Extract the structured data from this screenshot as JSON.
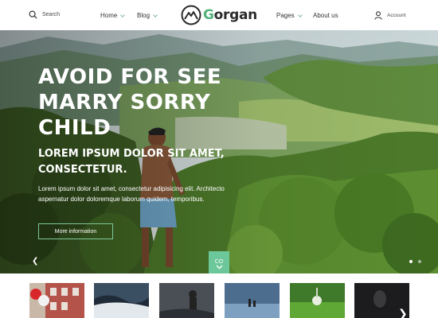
{
  "nav": {
    "search_label": "Search",
    "home_label": "Home",
    "blog_label": "Blog",
    "pages_label": "Pages",
    "about_label": "About us",
    "account_label": "Account",
    "logo_first": "G",
    "logo_rest": "organ"
  },
  "hero": {
    "title": "AVOID FOR SEE MARRY SORRY CHILD",
    "subtitle": "LOREM IPSUM DOLOR SIT AMET, CONSECTETUR.",
    "description": "Lorem ipsum dolor sit amet, consectetur adipisicing elit. Architecto aspernatur dolor doloremque laborum quidem, temporibus.",
    "button_label": "More information",
    "scroll_label": "CO"
  },
  "colors": {
    "accent": "#54b37c",
    "scroll_button": "#6cc79a"
  },
  "icons": {
    "search": "search-icon",
    "account": "user-icon",
    "logo": "mountain-logo-icon",
    "prev": "chevron-left-icon",
    "next": "chevron-right-icon",
    "scroll": "chevron-down-icon"
  }
}
